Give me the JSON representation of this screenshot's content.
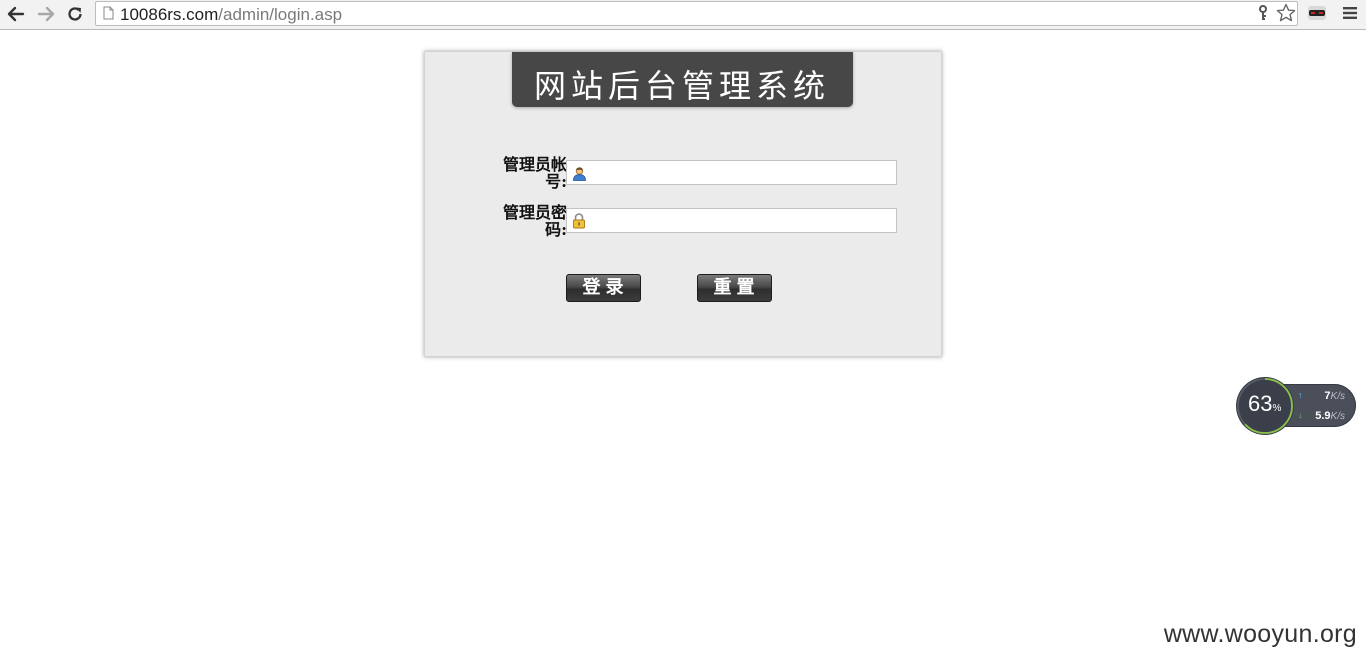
{
  "browser": {
    "url_host": "10086rs.com",
    "url_path": "/admin/login.asp",
    "back_icon": "back-arrow-icon",
    "forward_icon": "forward-arrow-icon",
    "reload_icon": "reload-icon",
    "page_icon": "page-icon",
    "key_icon": "key-icon",
    "bookmark_icon": "star-icon",
    "extension_icon": "incognito-mask-icon",
    "menu_icon": "hamburger-menu-icon"
  },
  "login": {
    "title": "网站后台管理系统",
    "username_label": "管理员帐号:",
    "username_value": "",
    "password_label": "管理员密码:",
    "password_value": "",
    "login_button": "登录",
    "reset_button": "重置",
    "banner_color": "#474747",
    "panel_color": "#ebebeb"
  },
  "speed_widget": {
    "percent": "63",
    "percent_unit": "%",
    "upload_value": "7",
    "upload_unit": "K/s",
    "download_value": "5.9",
    "download_unit": "K/s",
    "upload_color": "#4fc3f7",
    "download_color": "#66bb6a"
  },
  "watermark": "www.wooyun.org"
}
